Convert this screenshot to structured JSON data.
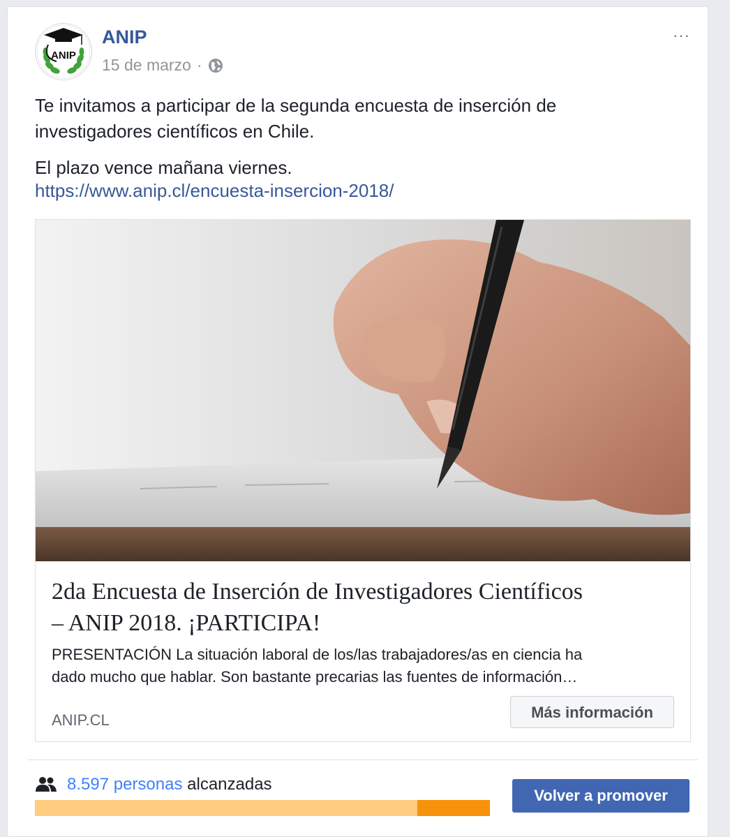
{
  "post": {
    "author": "ANIP",
    "date": "15 de marzo",
    "separator": "·",
    "privacy_icon": "globe-icon",
    "more_icon": "ellipsis-icon",
    "more_label": "···",
    "paragraphs": [
      "Te invitamos a participar de la segunda encuesta de inserción de",
      "investigadores científicos en Chile.",
      "El plazo vence mañana viernes."
    ],
    "link": "https://www.anip.cl/encuesta-insercion-2018/"
  },
  "avatar": {
    "logo_text": "ANIP"
  },
  "attachment": {
    "title_line1": "2da Encuesta de Inserción de Investigadores Científicos",
    "title_line2": "– ANIP 2018. ¡PARTICIPA!",
    "description_line1": "PRESENTACIÓN La situación laboral de los/las trabajadores/as en ciencia ha",
    "description_line2": "dado mucho que hablar. Son bastante precarias las fuentes de información…",
    "domain": "ANIP.CL",
    "button_label": "Más información"
  },
  "footer": {
    "people_icon": "people-icon",
    "reach_number": "8.597 personas",
    "reach_rest": "alcanzadas",
    "progress_fraction": 0.16,
    "promote_label": "Volver a promover"
  },
  "colors": {
    "link": "#385898",
    "author": "#365899",
    "reach": "#4080ff",
    "bar_base": "#ffcc80",
    "bar_fill": "#f7920a",
    "button": "#4267b2"
  }
}
